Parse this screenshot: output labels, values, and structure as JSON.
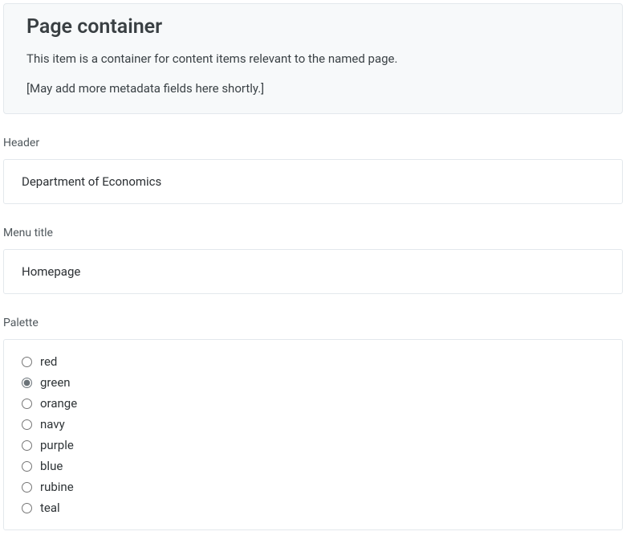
{
  "info": {
    "title": "Page container",
    "description": "This item is a container for content items relevant to the named page.",
    "note": "[May add more metadata fields here shortly.]"
  },
  "fields": {
    "header": {
      "label": "Header",
      "value": "Department of Economics"
    },
    "menu_title": {
      "label": "Menu title",
      "value": "Homepage"
    },
    "palette": {
      "label": "Palette",
      "selected": "green",
      "options": [
        {
          "value": "red",
          "label": "red"
        },
        {
          "value": "green",
          "label": "green"
        },
        {
          "value": "orange",
          "label": "orange"
        },
        {
          "value": "navy",
          "label": "navy"
        },
        {
          "value": "purple",
          "label": "purple"
        },
        {
          "value": "blue",
          "label": "blue"
        },
        {
          "value": "rubine",
          "label": "rubine"
        },
        {
          "value": "teal",
          "label": "teal"
        }
      ]
    }
  }
}
